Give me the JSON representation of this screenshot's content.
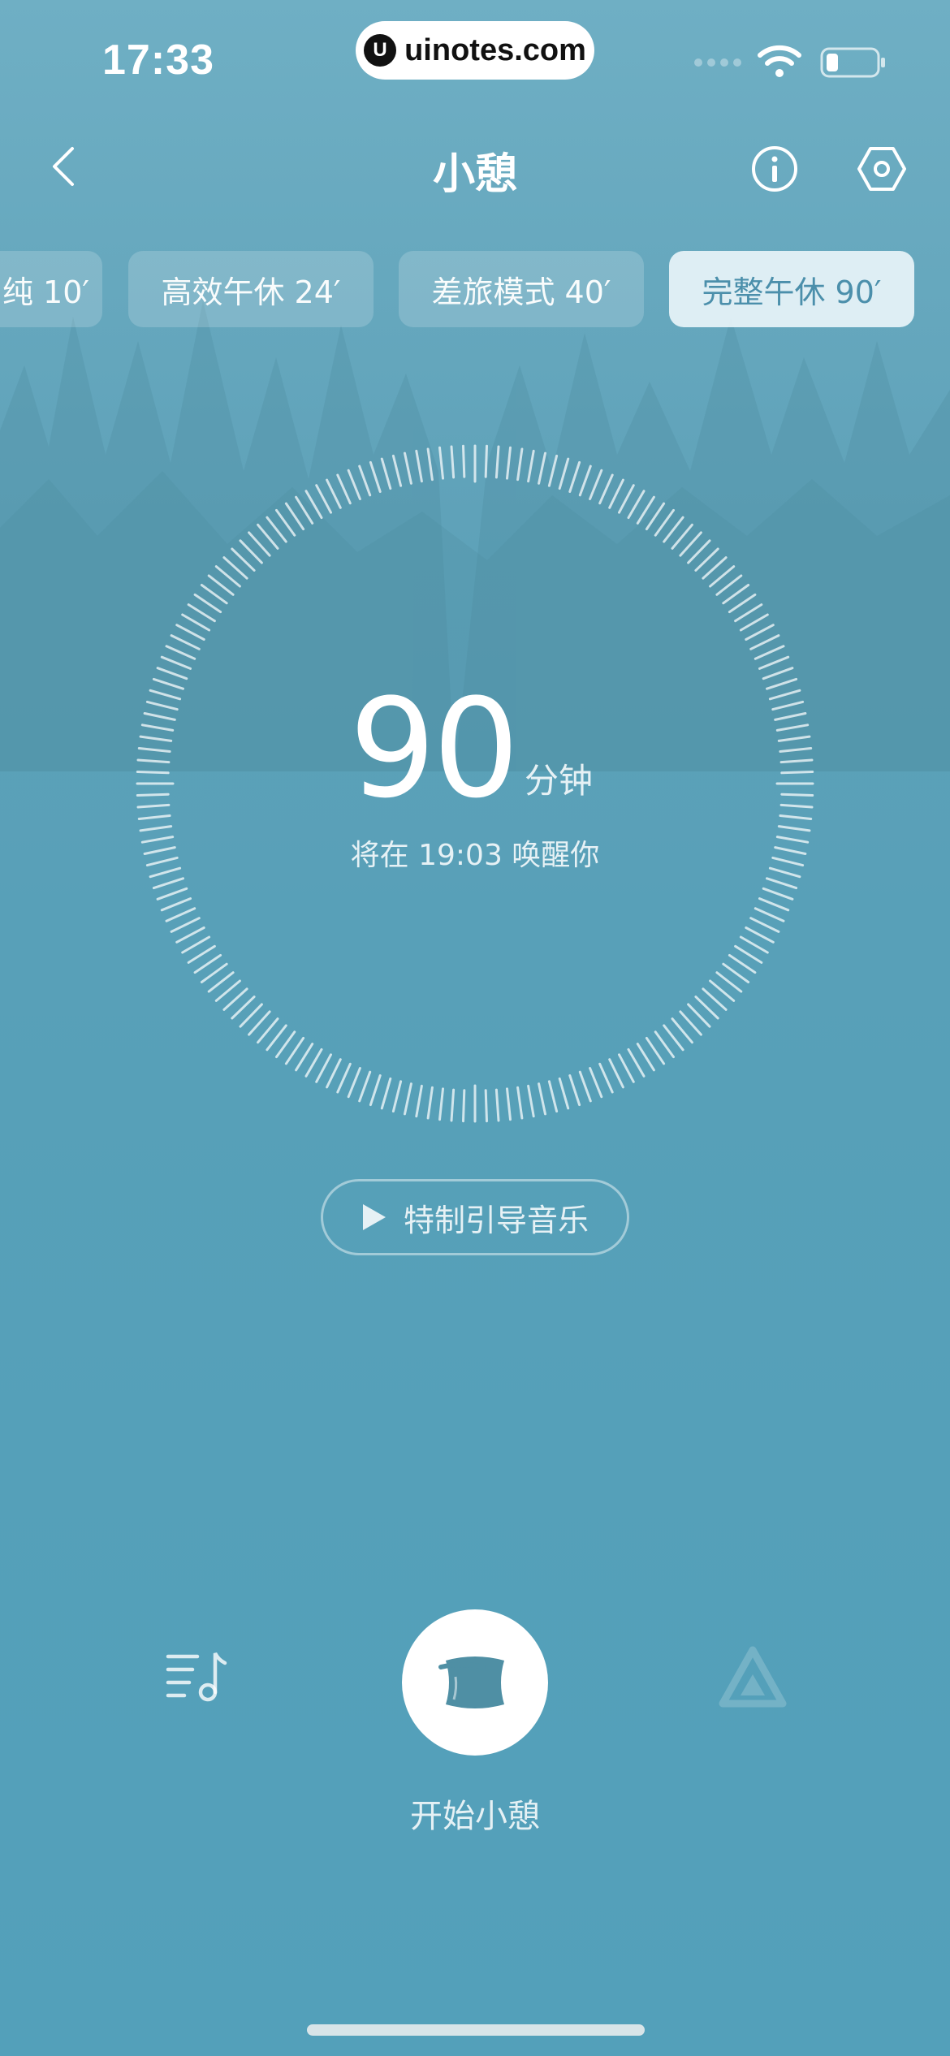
{
  "status_bar": {
    "time": "17:33",
    "watermark": "uinotes.com",
    "watermark_logo": "U"
  },
  "header": {
    "title": "小憩",
    "back_icon": "chevron-left-icon",
    "info_icon": "info-icon",
    "settings_icon": "hexagon-settings-icon"
  },
  "modes": [
    {
      "label": "纯 10′",
      "active": false
    },
    {
      "label": "高效午休 24′",
      "active": false
    },
    {
      "label": "差旅模式 40′",
      "active": false
    },
    {
      "label": "完整午休 90′",
      "active": true
    }
  ],
  "dial": {
    "minutes": "90",
    "unit": "分钟",
    "wake_text": "将在 19:03 唤醒你"
  },
  "music_guide": {
    "label": "特制引导音乐",
    "icon": "play-icon"
  },
  "bottom": {
    "start_label": "开始小憩",
    "start_icon": "pillow-icon",
    "playlist_icon": "playlist-music-icon",
    "alarm_icon": "triangle-alert-icon"
  },
  "colors": {
    "accent_active_text": "#4b8fab",
    "background_top": "#6fafc4",
    "background_bottom": "#53a0ba"
  }
}
